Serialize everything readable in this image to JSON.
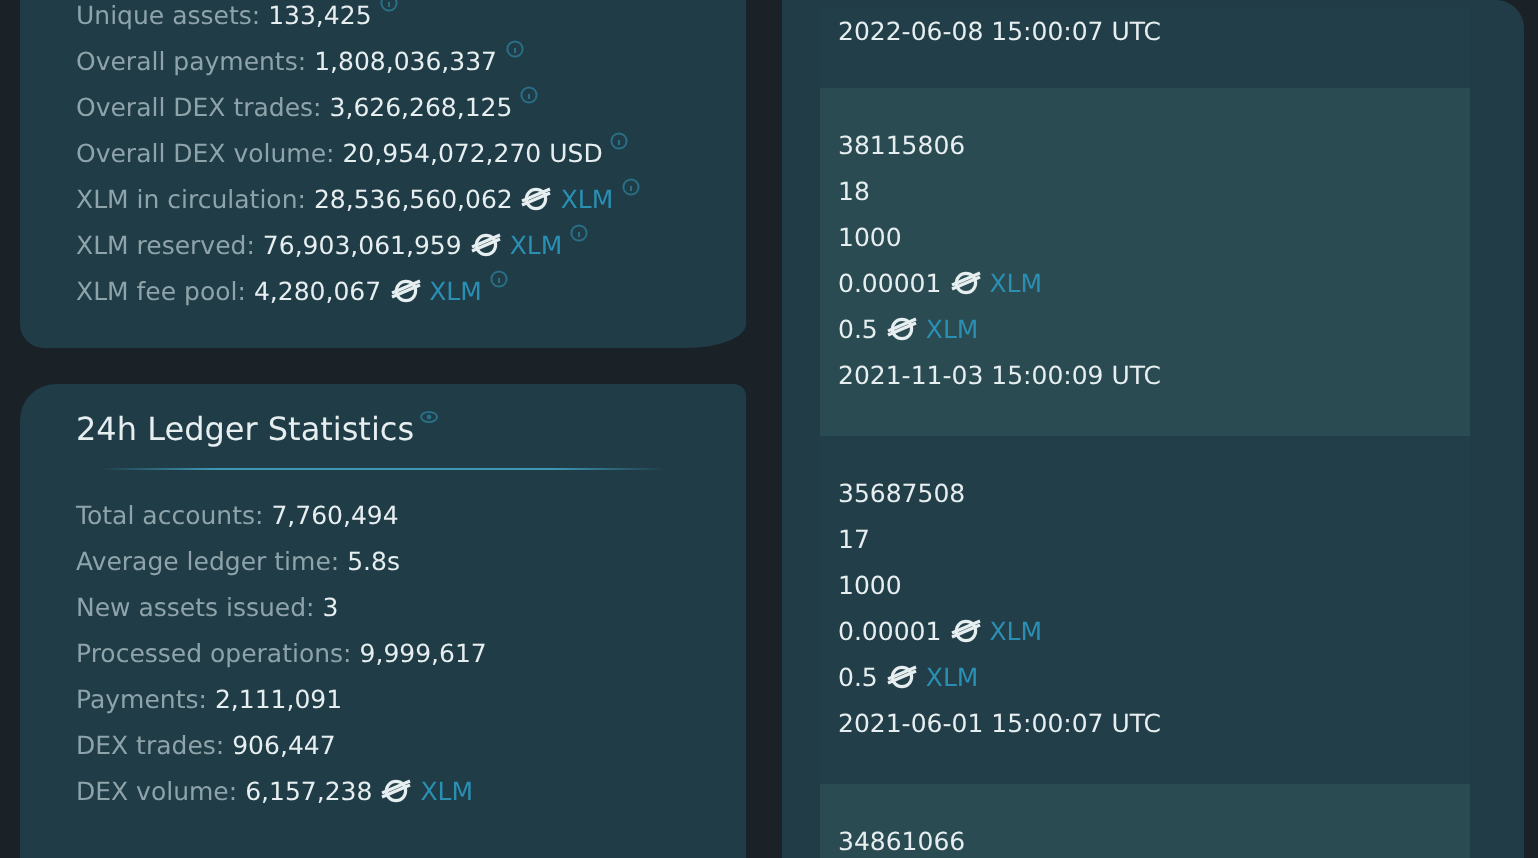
{
  "network_stats": {
    "lines": [
      {
        "label": "Unique assets:",
        "value": "133,425"
      },
      {
        "label": "Overall payments:",
        "value": "1,808,036,337"
      },
      {
        "label": "Overall DEX trades:",
        "value": "3,626,268,125"
      },
      {
        "label": "Overall DEX volume:",
        "value": "20,954,072,270 USD"
      },
      {
        "label": "XLM in circulation:",
        "value": "28,536,560,062",
        "asset": "XLM"
      },
      {
        "label": "XLM reserved:",
        "value": "76,903,061,959",
        "asset": "XLM"
      },
      {
        "label": "XLM fee pool:",
        "value": "4,280,067",
        "asset": "XLM"
      }
    ]
  },
  "ledger_stats": {
    "title": "24h Ledger Statistics",
    "lines": [
      {
        "label": "Total accounts:",
        "value": "7,760,494"
      },
      {
        "label": "Average ledger time:",
        "value": "5.8s"
      },
      {
        "label": "New assets issued:",
        "value": "3"
      },
      {
        "label": "Processed operations:",
        "value": "9,999,617"
      },
      {
        "label": "Payments:",
        "value": "2,111,091"
      },
      {
        "label": "DEX trades:",
        "value": "906,447"
      },
      {
        "label": "DEX volume:",
        "value": "6,157,238",
        "asset": "XLM"
      }
    ]
  },
  "protocol_history": [
    {
      "shaded": false,
      "fields": [
        {
          "value": "2022-06-08 15:00:07 UTC"
        }
      ]
    },
    {
      "shaded": true,
      "fields": [
        {
          "value": "38115806"
        },
        {
          "value": "18"
        },
        {
          "value": "1000"
        },
        {
          "value": "0.00001",
          "asset": "XLM"
        },
        {
          "value": "0.5",
          "asset": "XLM"
        },
        {
          "value": "2021-11-03 15:00:09 UTC"
        }
      ]
    },
    {
      "shaded": false,
      "fields": [
        {
          "value": "35687508"
        },
        {
          "value": "17"
        },
        {
          "value": "1000"
        },
        {
          "value": "0.00001",
          "asset": "XLM"
        },
        {
          "value": "0.5",
          "asset": "XLM"
        },
        {
          "value": "2021-06-01 15:00:07 UTC"
        }
      ]
    },
    {
      "shaded": true,
      "fields": [
        {
          "value": "34861066"
        }
      ]
    }
  ]
}
